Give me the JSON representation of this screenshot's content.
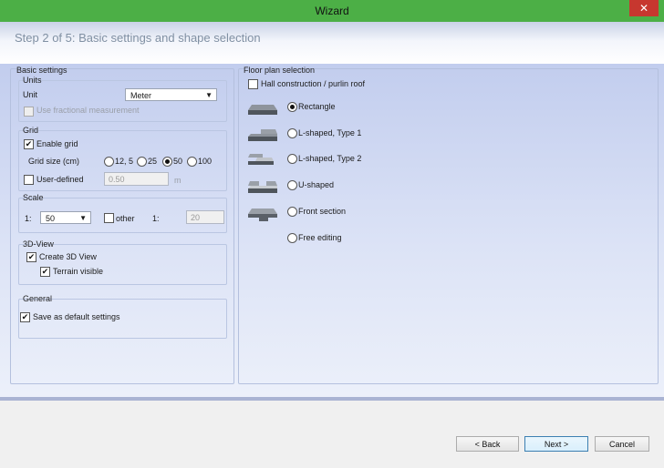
{
  "window": {
    "title": "Wizard",
    "close_glyph": "✕"
  },
  "step": {
    "title": "Step 2 of 5:  Basic settings and shape selection"
  },
  "basic": {
    "title": "Basic settings",
    "units": {
      "title": "Units",
      "unit_label": "Unit",
      "unit_value": "Meter",
      "fractional_label": "Use  fractional measurement",
      "fractional_checked": false,
      "fractional_enabled": false
    },
    "grid": {
      "title": "Grid",
      "enable_label": "Enable grid",
      "enable_checked": true,
      "size_label": "Grid size (cm)",
      "sizes": [
        "12, 5",
        "25",
        "50",
        "100"
      ],
      "selected_size": "50",
      "user_defined_label": "User-defined",
      "user_defined_checked": false,
      "user_defined_value": "0.50",
      "user_defined_unit": "m"
    },
    "scale": {
      "title": "Scale",
      "prefix": "1:",
      "value": "50",
      "other_label": "other",
      "other_checked": false,
      "other_prefix": "1:",
      "other_value": "20"
    },
    "view3d": {
      "title": "3D-View",
      "create_label": "Create 3D View",
      "create_checked": true,
      "terrain_label": "Terrain visible",
      "terrain_checked": true
    },
    "general": {
      "title": "General",
      "save_label": "Save as default settings",
      "save_checked": true
    }
  },
  "floor": {
    "title": "Floor plan selection",
    "hall_label": "Hall construction / purlin roof",
    "hall_checked": false,
    "shapes": [
      {
        "label": "Rectangle",
        "selected": true,
        "icon": "rectangle-shape-icon"
      },
      {
        "label": "L-shaped, Type 1",
        "selected": false,
        "icon": "l-shaped-type1-icon"
      },
      {
        "label": "L-shaped, Type 2",
        "selected": false,
        "icon": "l-shaped-type2-icon"
      },
      {
        "label": "U-shaped",
        "selected": false,
        "icon": "u-shaped-icon"
      },
      {
        "label": "Front section",
        "selected": false,
        "icon": "front-section-icon"
      },
      {
        "label": "Free editing",
        "selected": false,
        "icon": ""
      }
    ]
  },
  "buttons": {
    "back": "< Back",
    "next": "Next >",
    "cancel": "Cancel"
  },
  "colors": {
    "titlebar": "#4caf46",
    "close": "#c7372f",
    "step_text": "#8090a3"
  }
}
